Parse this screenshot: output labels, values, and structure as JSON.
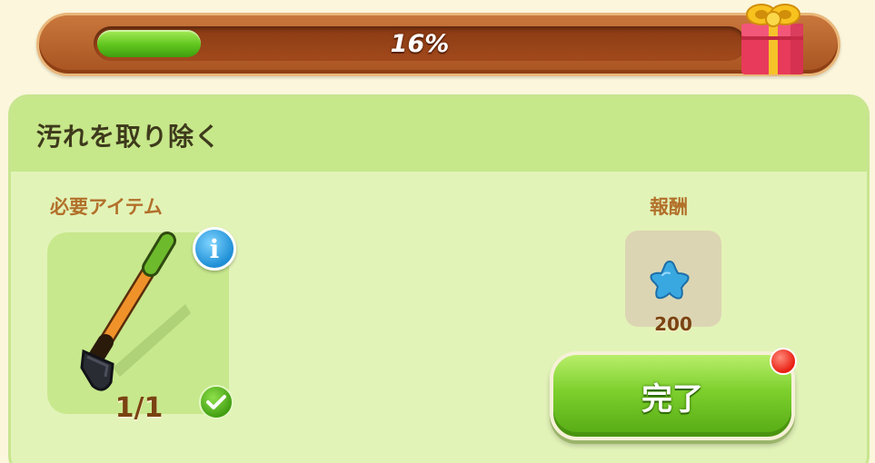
{
  "progress": {
    "percent": 0.16,
    "label": "16%"
  },
  "gift": {
    "icon": "gift-box-icon"
  },
  "panel": {
    "title": "汚れを取り除く",
    "required_label": "必要アイテム",
    "reward_label": "報酬"
  },
  "required_item": {
    "icon": "shovel-icon",
    "count": "1/1",
    "status_icon": "check-icon",
    "info_icon": "info-icon"
  },
  "reward": {
    "icon": "blue-star-icon",
    "amount": "200"
  },
  "complete_button": {
    "label": "完了",
    "notification_icon": "red-notification-dot"
  },
  "colors": {
    "background": "#fbf6dc",
    "panel": "#e2f3b8",
    "panel_header": "#c6e78a",
    "progress_frame": "#b8602a",
    "progress_fill": "#5fc51d",
    "button": "#7ccf2c",
    "label_brown": "#b2702a"
  }
}
